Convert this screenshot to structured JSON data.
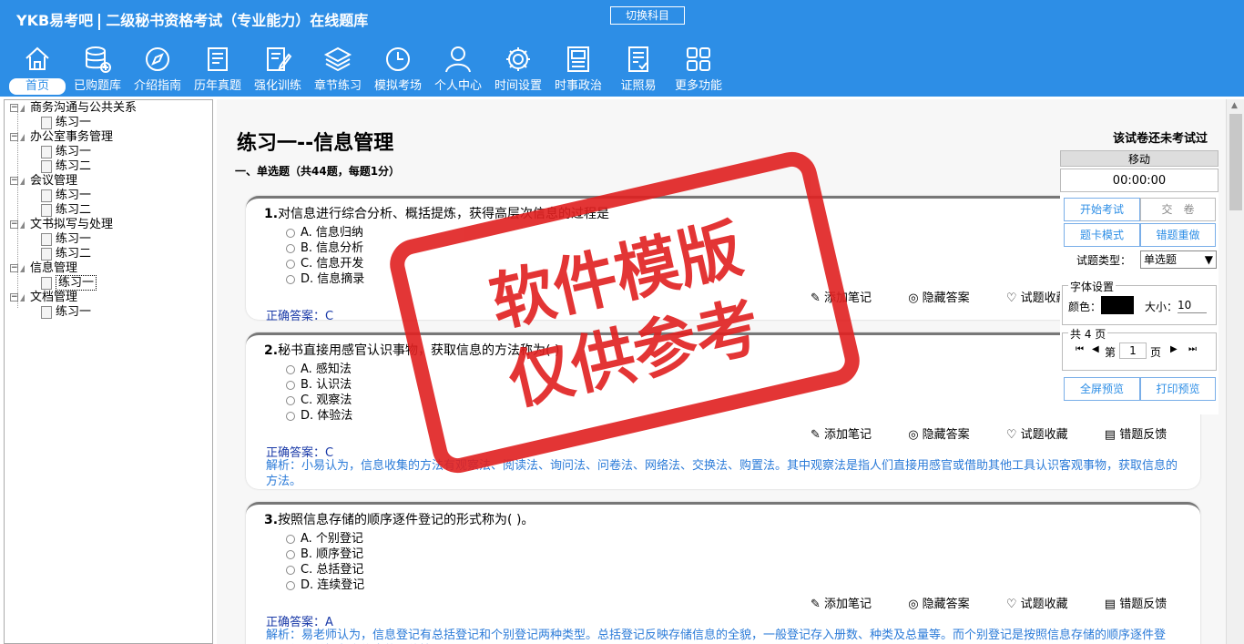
{
  "header": {
    "brand": "YKB易考吧",
    "title": "二级秘书资格考试（专业能力）在线题库",
    "switch_label": "切换科目"
  },
  "nav": [
    {
      "label": "首页",
      "icon": "home-icon"
    },
    {
      "label": "已购题库",
      "icon": "database-icon"
    },
    {
      "label": "介绍指南",
      "icon": "compass-icon"
    },
    {
      "label": "历年真题",
      "icon": "list-icon"
    },
    {
      "label": "强化训练",
      "icon": "edit-icon"
    },
    {
      "label": "章节练习",
      "icon": "layers-icon"
    },
    {
      "label": "模拟考场",
      "icon": "clock-icon"
    },
    {
      "label": "个人中心",
      "icon": "user-icon"
    },
    {
      "label": "时间设置",
      "icon": "gear-icon"
    },
    {
      "label": "时事政治",
      "icon": "news-icon"
    },
    {
      "label": "证照易",
      "icon": "certificate-icon"
    },
    {
      "label": "更多功能",
      "icon": "grid-icon"
    }
  ],
  "tree": {
    "chapters": [
      {
        "label": "商务沟通与公共关系",
        "items": [
          "练习一"
        ]
      },
      {
        "label": "办公室事务管理",
        "items": [
          "练习一",
          "练习二"
        ]
      },
      {
        "label": "会议管理",
        "items": [
          "练习一",
          "练习二"
        ]
      },
      {
        "label": "文书拟写与处理",
        "items": [
          "练习一",
          "练习二"
        ]
      },
      {
        "label": "信息管理",
        "items": [
          "练习一"
        ]
      },
      {
        "label": "文档管理",
        "items": [
          "练习一"
        ]
      }
    ],
    "selected": "信息管理 / 练习一"
  },
  "paper": {
    "title": "练习一--信息管理",
    "status": "该试卷还未考试过",
    "section": "一、单选题（共44题，每题1分）"
  },
  "tools": {
    "note": "添加笔记",
    "hide": "隐藏答案",
    "fav": "试题收藏",
    "feedback": "错题反馈"
  },
  "questions": [
    {
      "num": "1.",
      "stem": "对信息进行综合分析、概括提炼，获得高层次信息的过程是",
      "options": [
        "A. 信息归纳",
        "B. 信息分析",
        "C. 信息开发",
        "D. 信息摘录"
      ],
      "answer_label": "正确答案：",
      "answer": "C",
      "explanation": ""
    },
    {
      "num": "2.",
      "stem": "秘书直接用感官认识事物，获取信息的方法称为( )",
      "options": [
        "A. 感知法",
        "B. 认识法",
        "C. 观察法",
        "D. 体验法"
      ],
      "answer_label": "正确答案：",
      "answer": "C",
      "explanation": "解析：小易认为，信息收集的方法有观察法、阅读法、询问法、问卷法、网络法、交换法、购置法。其中观察法是指人们直接用感官或借助其他工具认识客观事物，获取信息的方法。"
    },
    {
      "num": "3.",
      "stem": "按照信息存储的顺序逐件登记的形式称为( )。",
      "options": [
        "A. 个别登记",
        "B. 顺序登记",
        "C. 总括登记",
        "D. 连续登记"
      ],
      "answer_label": "正确答案：",
      "answer": "A",
      "explanation": "解析：易老师认为，信息登记有总括登记和个别登记两种类型。总括登记反映存储信息的全貌，一般登记存入册数、种类及总量等。而个别登记是按照信息存储的顺序逐件登记，便于掌握各类信息的具体情况。"
    }
  ],
  "panel": {
    "move": "移动",
    "timer": "00:00:00",
    "start": "开始考试",
    "submit": "交　卷",
    "card_mode": "题卡模式",
    "wrong_redo": "错题重做",
    "type_label": "试题类型：",
    "type_value": "单选题",
    "font_legend": "字体设置",
    "color_label": "颜色：",
    "size_label": "大小：",
    "size_value": "10",
    "pages_legend": "共 4 页",
    "page_prefix": "第",
    "page_value": "1",
    "page_suffix": "页",
    "fullscreen": "全屏预览",
    "print": "打印预览"
  },
  "watermark": {
    "line1": "软件模版",
    "line2": "仅供参考"
  },
  "colors": {
    "header_bg": "#2d8ee6",
    "answer": "#1a3aa8",
    "explanation": "#2b7bd8",
    "stamp": "#e02020"
  }
}
